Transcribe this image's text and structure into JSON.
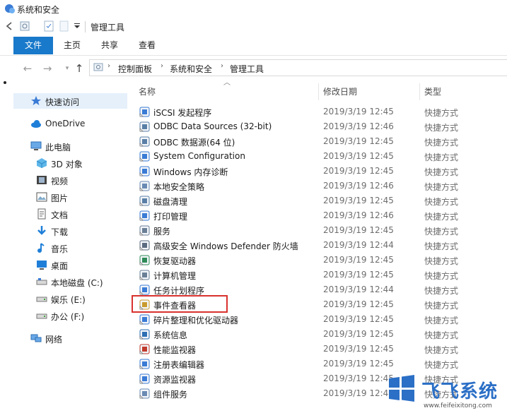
{
  "window": {
    "title": "系统和安全",
    "qat_title": "管理工具"
  },
  "ribbon": {
    "tabs": [
      {
        "label": "文件"
      },
      {
        "label": "主页"
      },
      {
        "label": "共享"
      },
      {
        "label": "查看"
      }
    ]
  },
  "address": {
    "crumbs": [
      "控制面板",
      "系统和安全",
      "管理工具"
    ]
  },
  "sidebar": {
    "items": [
      {
        "label": "快速访问",
        "icon": "star-icon"
      },
      {
        "label": "OneDrive",
        "icon": "cloud-icon"
      },
      {
        "label": "此电脑",
        "icon": "computer-icon"
      },
      {
        "label": "3D 对象",
        "icon": "cube-icon"
      },
      {
        "label": "视频",
        "icon": "video-icon"
      },
      {
        "label": "图片",
        "icon": "picture-icon"
      },
      {
        "label": "文档",
        "icon": "document-icon"
      },
      {
        "label": "下载",
        "icon": "download-icon"
      },
      {
        "label": "音乐",
        "icon": "music-icon"
      },
      {
        "label": "桌面",
        "icon": "desktop-icon"
      },
      {
        "label": "本地磁盘 (C:)",
        "icon": "drive-icon"
      },
      {
        "label": "娱乐 (E:)",
        "icon": "drive-icon"
      },
      {
        "label": "办公 (F:)",
        "icon": "drive-icon"
      },
      {
        "label": "网络",
        "icon": "network-icon"
      }
    ]
  },
  "columns": {
    "name": "名称",
    "date": "修改日期",
    "type": "类型"
  },
  "files": [
    {
      "name": "iSCSI 发起程序",
      "date": "2019/3/19 12:45",
      "type": "快捷方式",
      "icon": "iscsi-icon"
    },
    {
      "name": "ODBC Data Sources (32-bit)",
      "date": "2019/3/19 12:46",
      "type": "快捷方式",
      "icon": "odbc-icon"
    },
    {
      "name": "ODBC 数据源(64 位)",
      "date": "2019/3/19 12:45",
      "type": "快捷方式",
      "icon": "odbc-icon"
    },
    {
      "name": "System Configuration",
      "date": "2019/3/19 12:45",
      "type": "快捷方式",
      "icon": "system-config-icon"
    },
    {
      "name": "Windows 内存诊断",
      "date": "2019/3/19 12:45",
      "type": "快捷方式",
      "icon": "memory-diagnostic-icon"
    },
    {
      "name": "本地安全策略",
      "date": "2019/3/19 12:46",
      "type": "快捷方式",
      "icon": "security-policy-icon"
    },
    {
      "name": "磁盘清理",
      "date": "2019/3/19 12:45",
      "type": "快捷方式",
      "icon": "disk-cleanup-icon"
    },
    {
      "name": "打印管理",
      "date": "2019/3/19 12:46",
      "type": "快捷方式",
      "icon": "print-management-icon"
    },
    {
      "name": "服务",
      "date": "2019/3/19 12:45",
      "type": "快捷方式",
      "icon": "services-icon"
    },
    {
      "name": "高级安全 Windows Defender 防火墙",
      "date": "2019/3/19 12:44",
      "type": "快捷方式",
      "icon": "firewall-icon"
    },
    {
      "name": "恢复驱动器",
      "date": "2019/3/19 12:45",
      "type": "快捷方式",
      "icon": "recovery-drive-icon"
    },
    {
      "name": "计算机管理",
      "date": "2019/3/19 12:45",
      "type": "快捷方式",
      "icon": "computer-management-icon"
    },
    {
      "name": "任务计划程序",
      "date": "2019/3/19 12:44",
      "type": "快捷方式",
      "icon": "task-scheduler-icon"
    },
    {
      "name": "事件查看器",
      "date": "2019/3/19 12:45",
      "type": "快捷方式",
      "icon": "event-viewer-icon"
    },
    {
      "name": "碎片整理和优化驱动器",
      "date": "2019/3/19 12:45",
      "type": "快捷方式",
      "icon": "defrag-icon"
    },
    {
      "name": "系统信息",
      "date": "2019/3/19 12:45",
      "type": "快捷方式",
      "icon": "system-info-icon"
    },
    {
      "name": "性能监视器",
      "date": "2019/3/19 12:45",
      "type": "快捷方式",
      "icon": "performance-monitor-icon"
    },
    {
      "name": "注册表编辑器",
      "date": "2019/3/19 12:45",
      "type": "快捷方式",
      "icon": "registry-editor-icon"
    },
    {
      "name": "资源监视器",
      "date": "2019/3/19 12:45",
      "type": "快捷方式",
      "icon": "resource-monitor-icon"
    },
    {
      "name": "组件服务",
      "date": "2019/3/19 12:45",
      "type": "快捷方式",
      "icon": "component-services-icon"
    }
  ],
  "watermark": {
    "text": "飞飞系统",
    "url": "www.feifeixitong.com"
  },
  "colors": {
    "accent": "#1979ca",
    "highlight": "#d9322e",
    "hover": "#e5f0fb",
    "watermark": "#2b6fc6"
  }
}
